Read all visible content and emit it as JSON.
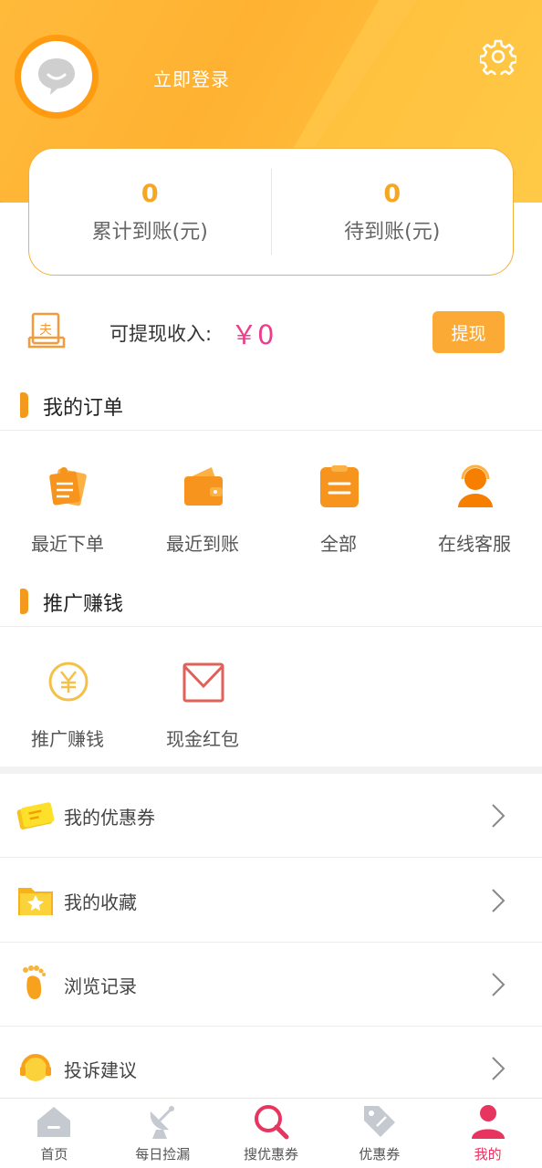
{
  "header": {
    "login_label": "立即登录",
    "avatar_icon": "chat-bubble-avatar-icon",
    "settings_icon": "gear-icon"
  },
  "stats": {
    "total_value": "0",
    "total_label": "累计到账(元)",
    "pending_value": "0",
    "pending_label": "待到账(元)"
  },
  "withdraw": {
    "icon": "book-icon",
    "label": "可提现收入:",
    "amount": "￥0",
    "button_label": "提现"
  },
  "orders": {
    "title": "我的订单",
    "items": [
      {
        "label": "最近下单",
        "icon": "note-pin-icon"
      },
      {
        "label": "最近到账",
        "icon": "wallet-icon"
      },
      {
        "label": "全部",
        "icon": "clipboard-icon"
      },
      {
        "label": "在线客服",
        "icon": "customer-service-icon"
      }
    ]
  },
  "promote": {
    "title": "推广赚钱",
    "items": [
      {
        "label": "推广赚钱",
        "icon": "yen-coin-icon"
      },
      {
        "label": "现金红包",
        "icon": "envelope-icon"
      }
    ]
  },
  "menu": [
    {
      "label": "我的优惠券",
      "icon": "ticket-icon"
    },
    {
      "label": "我的收藏",
      "icon": "star-folder-icon"
    },
    {
      "label": "浏览记录",
      "icon": "footprint-icon"
    },
    {
      "label": "投诉建议",
      "icon": "headset-icon"
    }
  ],
  "tabbar": [
    {
      "label": "首页",
      "icon": "home-icon",
      "active": false
    },
    {
      "label": "每日捡漏",
      "icon": "satellite-dish-icon",
      "active": false
    },
    {
      "label": "搜优惠券",
      "icon": "search-icon",
      "active": false
    },
    {
      "label": "优惠券",
      "icon": "tag-icon",
      "active": false
    },
    {
      "label": "我的",
      "icon": "user-icon",
      "active": true
    }
  ],
  "colors": {
    "brand_orange": "#ffb32b",
    "accent_pink": "#ee3b8b",
    "active_tab": "#e8355f"
  }
}
